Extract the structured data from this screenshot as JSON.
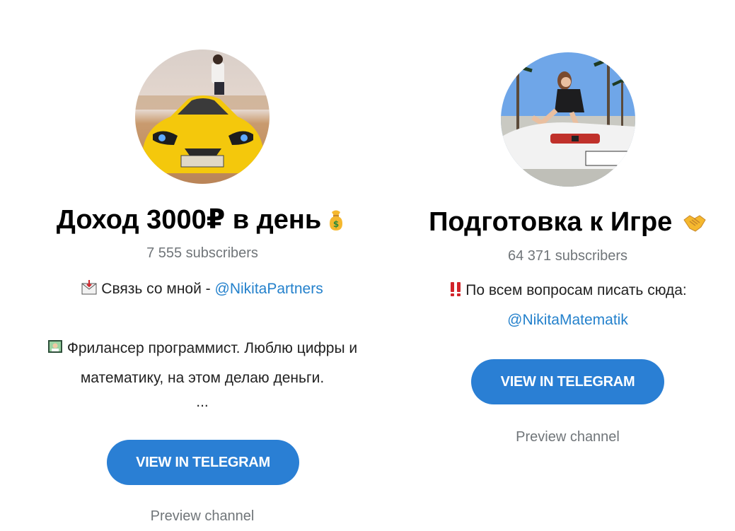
{
  "channels": [
    {
      "title": "Доход 3000₽ в день",
      "title_icon": "money-bag-icon",
      "subscribers": "7 555 subscribers",
      "contact_prefix": "Связь со мной - ",
      "contact_icon": "envelope-icon",
      "contact_link": "@NikitaPartners",
      "bio_icon": "programmer-icon",
      "bio_line1": "Фрилансер программист. Люблю цифры и",
      "bio_line2": "математику, на этом делаю деньги.",
      "ellipsis": "...",
      "button_label": "VIEW IN TELEGRAM",
      "preview_label": "Preview channel",
      "avatar_icon": "yellow-sports-car-avatar"
    },
    {
      "title": "Подготовка к Игре",
      "title_icon": "handshake-icon",
      "subscribers": "64 371 subscribers",
      "contact_icon": "double-exclamation-icon",
      "contact_prefix": "По всем вопросам писать сюда:",
      "contact_link": "@NikitaMatematik",
      "button_label": "VIEW IN TELEGRAM",
      "preview_label": "Preview channel",
      "avatar_icon": "white-car-palm-trees-avatar"
    }
  ],
  "colors": {
    "button": "#2a7fd4",
    "link": "#2481cc",
    "muted": "#707579"
  }
}
